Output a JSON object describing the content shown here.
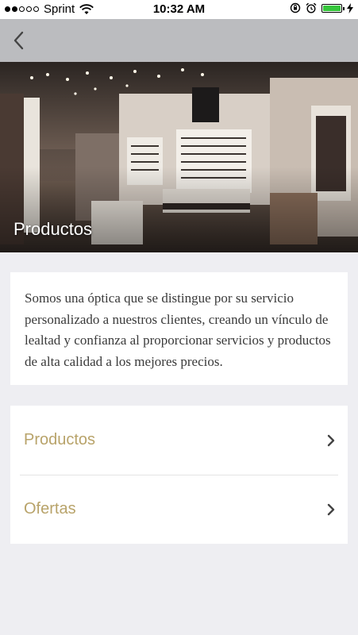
{
  "status_bar": {
    "carrier": "Sprint",
    "time": "10:32 AM",
    "battery_level": 1.0,
    "battery_color": "#35c63b",
    "signal_bars": 2,
    "icons": [
      "wifi-icon",
      "lock-rotation-icon",
      "alarm-icon",
      "battery-icon",
      "charging-bolt-icon"
    ]
  },
  "nav": {
    "back_icon": "chevron-left-icon"
  },
  "hero": {
    "title": "Productos"
  },
  "intro": {
    "text": "Somos una óptica que se distingue por su servicio personalizado a nuestros clientes, creando un vínculo de lealtad y confianza al proporcionar servicios y productos de alta calidad a los mejores precios."
  },
  "menu": {
    "items": [
      {
        "label": "Productos",
        "icon": "chevron-right-icon"
      },
      {
        "label": "Ofertas",
        "icon": "chevron-right-icon"
      }
    ]
  },
  "colors": {
    "nav_background": "#bbbcbf",
    "page_background": "#eeeef2",
    "menu_label": "#b8a36a",
    "chevron": "#444444"
  }
}
